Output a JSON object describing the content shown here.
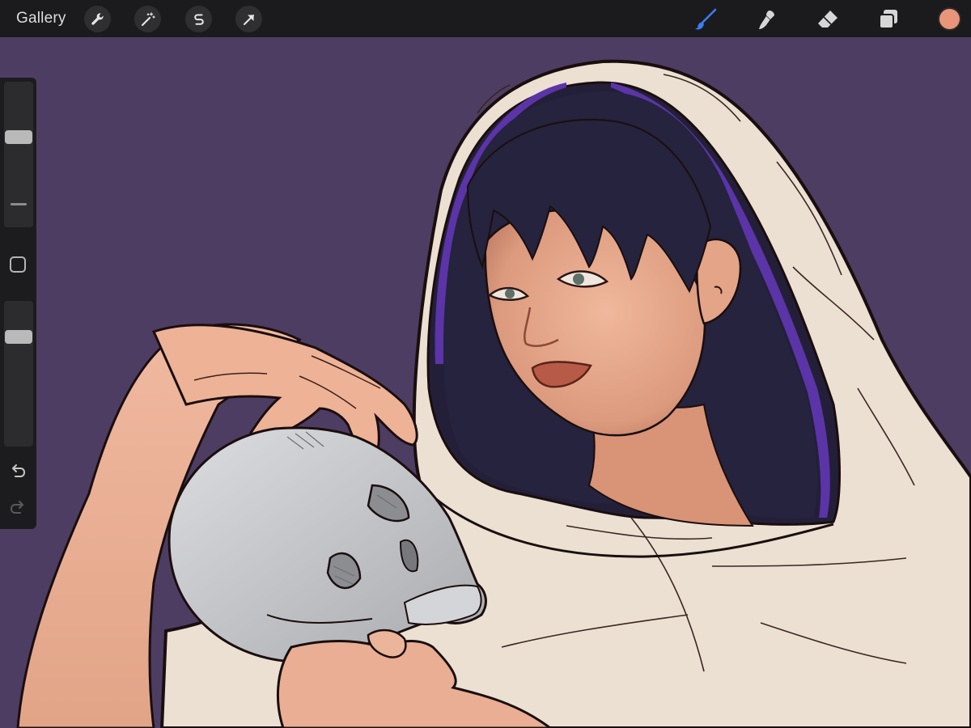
{
  "topbar": {
    "gallery_label": "Gallery",
    "left_tools": [
      "wrench-icon",
      "magic-wand-icon",
      "selection-s-icon",
      "transform-arrow-icon"
    ],
    "right_tools": [
      "brush-icon",
      "smudge-icon",
      "eraser-icon",
      "layers-icon"
    ],
    "active_tool": "brush-icon",
    "current_color": "#e8957a"
  },
  "sidebar": {
    "brush_size_level": 0.63,
    "brush_opacity_level": 0.78,
    "items": [
      "brush-size-slider",
      "modify-button",
      "opacity-slider",
      "undo-icon",
      "redo-icon"
    ]
  },
  "canvas": {
    "background_color": "#4e3d62",
    "accent_colors": {
      "hood": "#ebe0d2",
      "hair": "#23213a",
      "hair_rim": "#5b34a8",
      "skin": "#e8aa8c",
      "skull": "#c9cacd",
      "outline": "#1a0e0e"
    }
  }
}
